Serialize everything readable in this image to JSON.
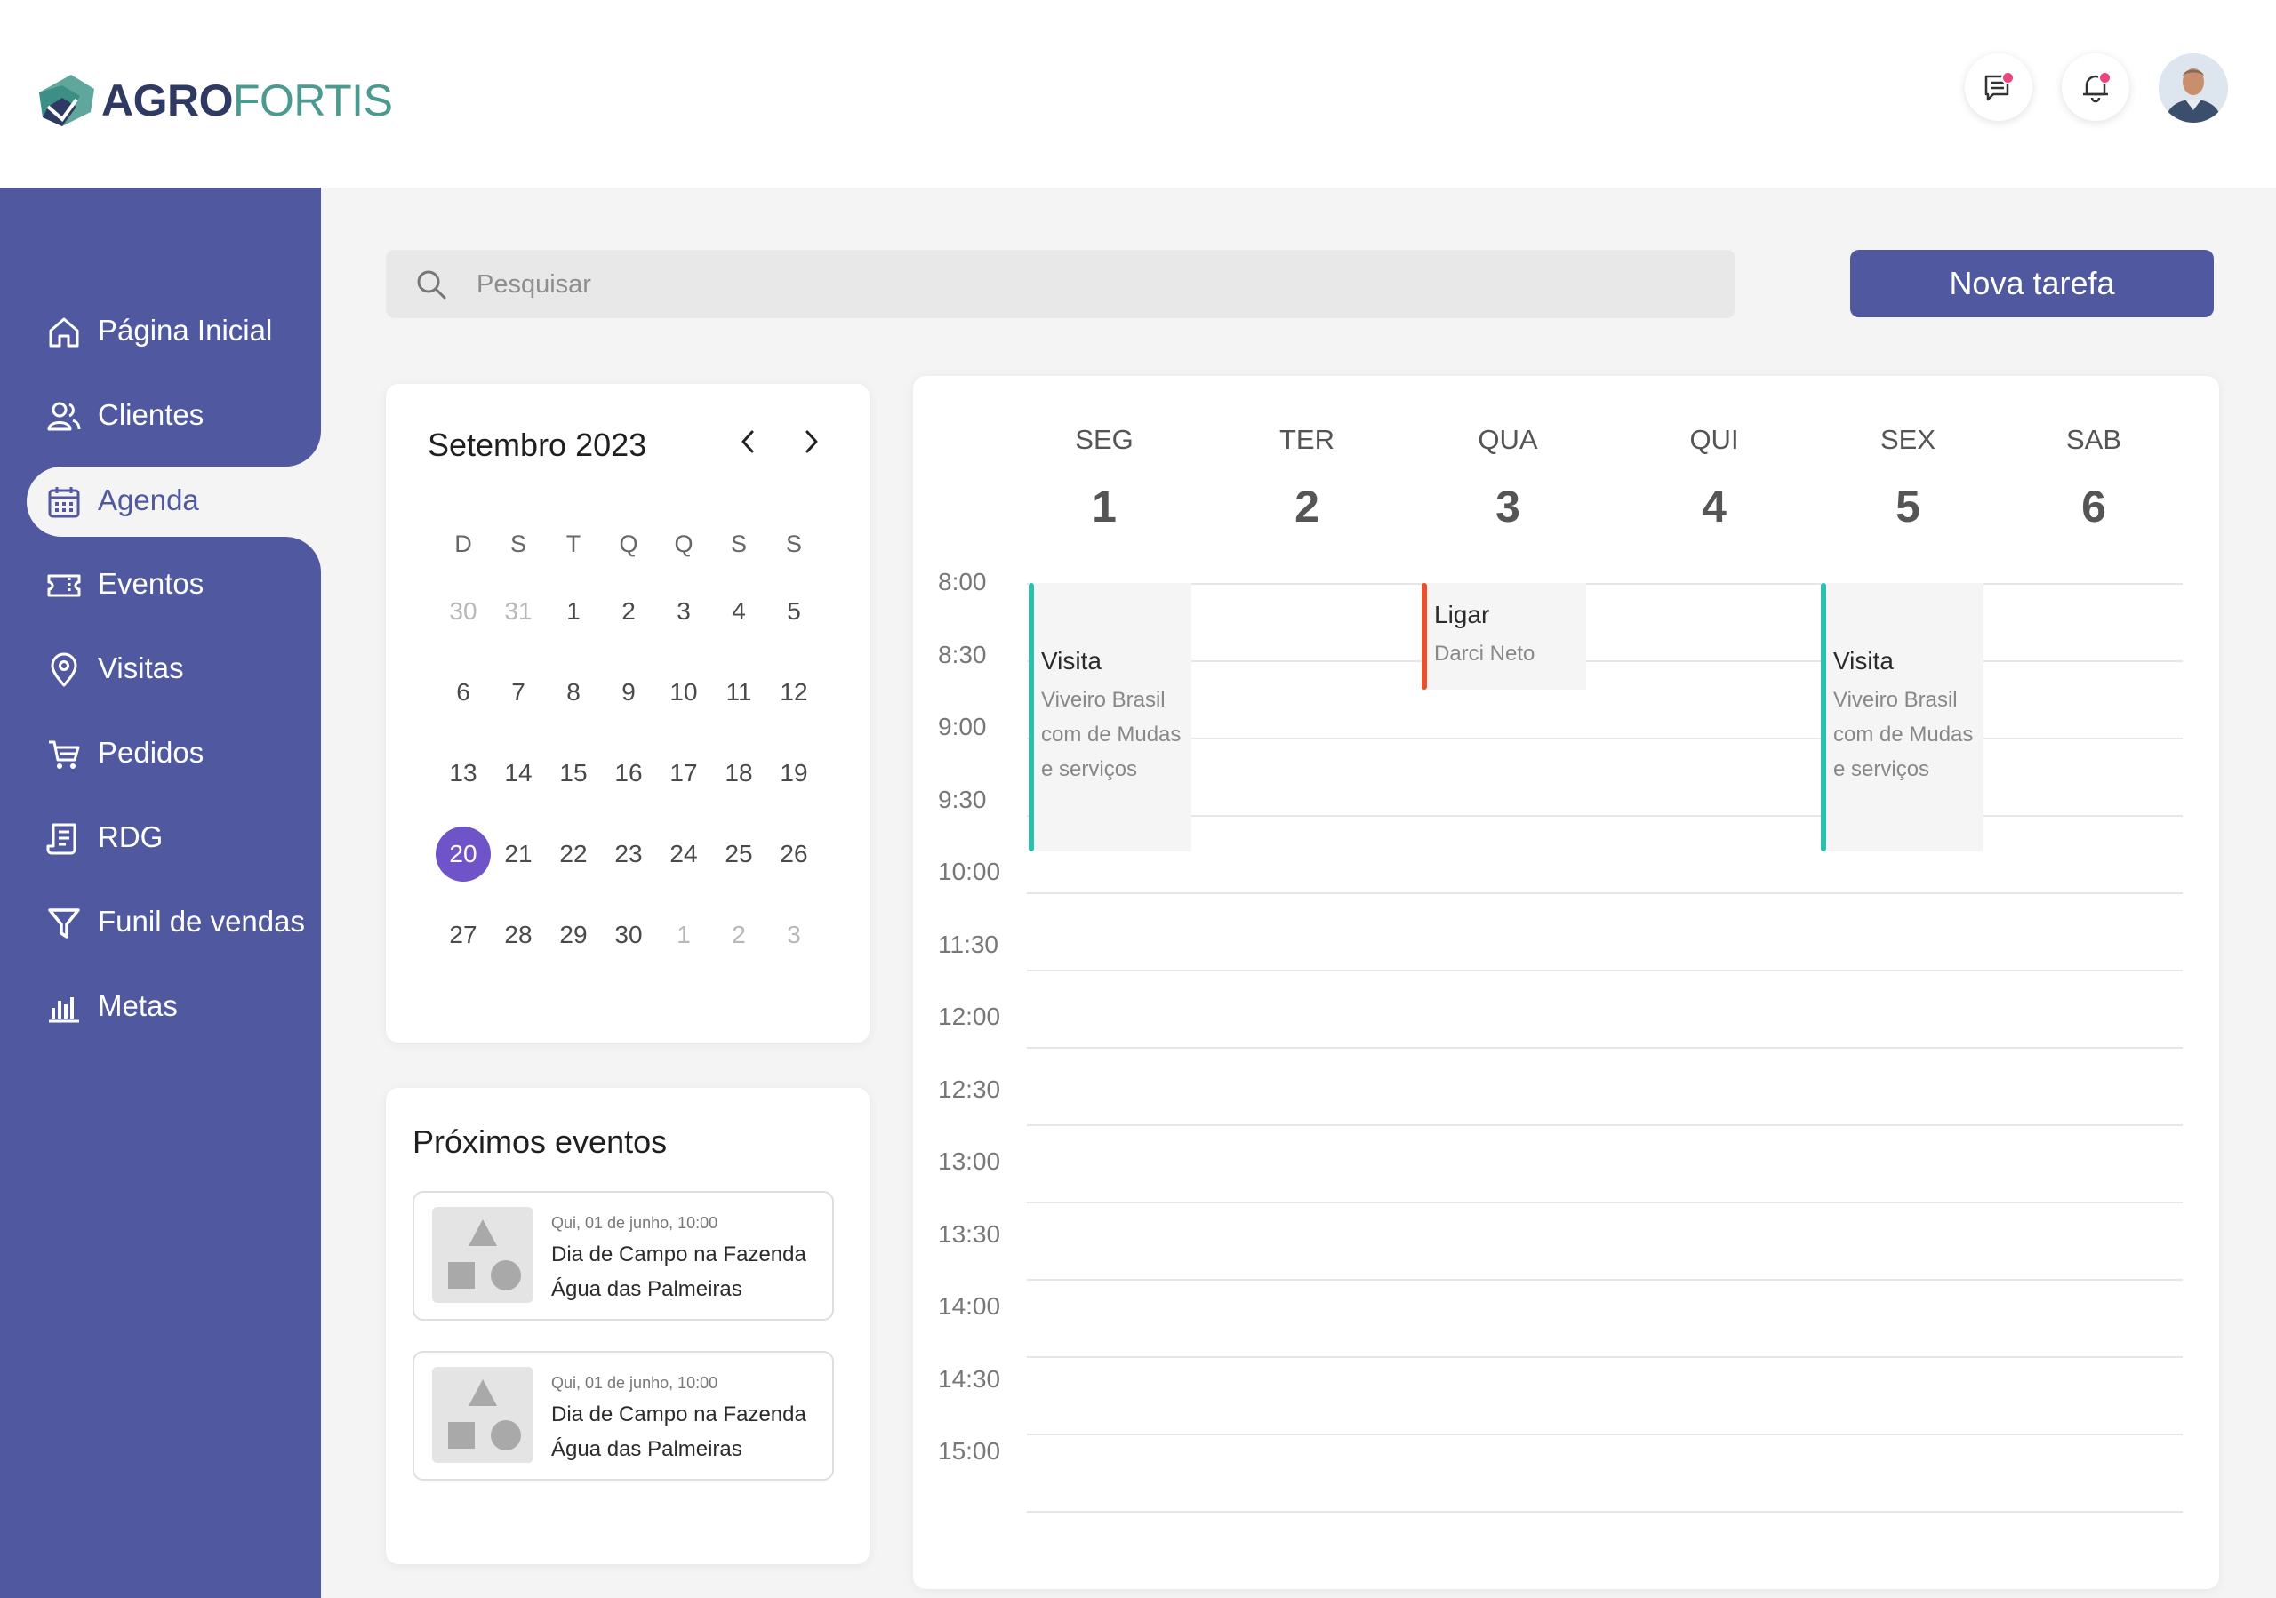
{
  "brand": {
    "part1": "AGRO",
    "part2": "FORTIS"
  },
  "header": {
    "messages_icon": "message-icon",
    "notifications_icon": "bell-icon",
    "accent_dot_color": "#e8467c"
  },
  "sidebar": {
    "color": "#5059a0",
    "items": [
      {
        "label": "Página Inicial",
        "icon": "home-icon"
      },
      {
        "label": "Clientes",
        "icon": "users-icon"
      },
      {
        "label": "Agenda",
        "icon": "calendar-icon",
        "active": true
      },
      {
        "label": "Eventos",
        "icon": "ticket-icon"
      },
      {
        "label": "Visitas",
        "icon": "map-pin-icon"
      },
      {
        "label": "Pedidos",
        "icon": "cart-icon"
      },
      {
        "label": "RDG",
        "icon": "receipt-icon"
      },
      {
        "label": "Funil de vendas",
        "icon": "funnel-icon"
      },
      {
        "label": "Metas",
        "icon": "bar-chart-icon"
      }
    ]
  },
  "search": {
    "placeholder": "Pesquisar"
  },
  "new_task_label": "Nova tarefa",
  "mini_calendar": {
    "title": "Setembro 2023",
    "weekdays": [
      "D",
      "S",
      "T",
      "Q",
      "Q",
      "S",
      "S"
    ],
    "weeks": [
      [
        {
          "d": "30",
          "dim": true
        },
        {
          "d": "31",
          "dim": true
        },
        {
          "d": "1"
        },
        {
          "d": "2"
        },
        {
          "d": "3"
        },
        {
          "d": "4"
        },
        {
          "d": "5"
        }
      ],
      [
        {
          "d": "6"
        },
        {
          "d": "7"
        },
        {
          "d": "8"
        },
        {
          "d": "9"
        },
        {
          "d": "10"
        },
        {
          "d": "11"
        },
        {
          "d": "12"
        }
      ],
      [
        {
          "d": "13"
        },
        {
          "d": "14"
        },
        {
          "d": "15"
        },
        {
          "d": "16"
        },
        {
          "d": "17"
        },
        {
          "d": "18"
        },
        {
          "d": "19"
        }
      ],
      [
        {
          "d": "20",
          "today": true
        },
        {
          "d": "21"
        },
        {
          "d": "22"
        },
        {
          "d": "23"
        },
        {
          "d": "24"
        },
        {
          "d": "25"
        },
        {
          "d": "26"
        }
      ],
      [
        {
          "d": "27"
        },
        {
          "d": "28"
        },
        {
          "d": "29"
        },
        {
          "d": "30"
        },
        {
          "d": "1",
          "dim": true
        },
        {
          "d": "2",
          "dim": true
        },
        {
          "d": "3",
          "dim": true
        }
      ]
    ]
  },
  "upcoming": {
    "title": "Próximos eventos",
    "items": [
      {
        "date": "Qui, 01 de junho, 10:00",
        "name": "Dia de Campo na Fazenda Água das Palmeiras"
      },
      {
        "date": "Qui, 01 de junho, 10:00",
        "name": "Dia de Campo na Fazenda Água das Palmeiras"
      }
    ]
  },
  "week": {
    "days": [
      {
        "name": "SEG",
        "num": "1"
      },
      {
        "name": "TER",
        "num": "2"
      },
      {
        "name": "QUA",
        "num": "3"
      },
      {
        "name": "QUI",
        "num": "4"
      },
      {
        "name": "SEX",
        "num": "5"
      },
      {
        "name": "SAB",
        "num": "6"
      }
    ],
    "times": [
      "8:00",
      "8:30",
      "9:00",
      "9:30",
      "10:00",
      "11:30",
      "12:00",
      "12:30",
      "13:00",
      "13:30",
      "14:00",
      "14:30",
      "15:00"
    ],
    "events": [
      {
        "day": "SEG",
        "title": "Visita",
        "subtitle_lines": [
          "Viveiro Brasil",
          "com de Mudas",
          "e serviços"
        ],
        "color": "#2bbfae"
      },
      {
        "day": "QUA",
        "title": "Ligar",
        "subtitle_lines": [
          "Darci Neto"
        ],
        "color": "#e8502e"
      },
      {
        "day": "SEX",
        "title": "Visita",
        "subtitle_lines": [
          "Viveiro Brasil",
          "com de Mudas",
          "e serviços"
        ],
        "color": "#2bbfae"
      }
    ]
  }
}
